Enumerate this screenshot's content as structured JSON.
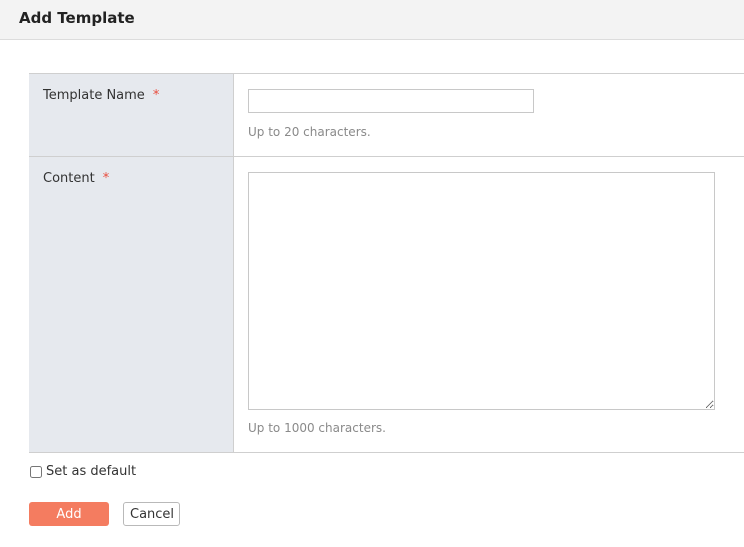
{
  "header": {
    "title": "Add Template"
  },
  "form": {
    "template_name": {
      "label": "Template Name",
      "required_mark": "*",
      "value": "",
      "hint": "Up to 20 characters."
    },
    "content": {
      "label": "Content",
      "required_mark": "*",
      "value": "",
      "hint": "Up to 1000 characters."
    },
    "set_default": {
      "label": "Set as default",
      "checked": false
    }
  },
  "actions": {
    "add_label": "Add",
    "cancel_label": "Cancel"
  },
  "colors": {
    "accent": "#f47c60",
    "required": "#e84c3d",
    "label_bg": "#e6e9ee"
  }
}
